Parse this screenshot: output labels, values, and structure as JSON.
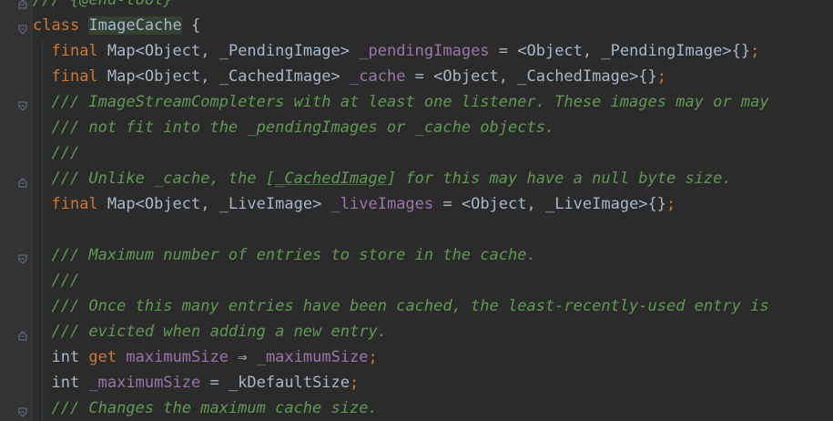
{
  "editor": {
    "lines": [
      [
        {
          "t": "/// {@end-tool}",
          "c": "doc"
        }
      ],
      [
        {
          "t": "class",
          "c": "kw"
        },
        {
          "t": " ",
          "c": "plain"
        },
        {
          "t": "ImageCache",
          "c": "hl plain"
        },
        {
          "t": " {",
          "c": "plain"
        }
      ],
      [
        {
          "t": "  ",
          "c": "plain"
        },
        {
          "t": "final",
          "c": "kw"
        },
        {
          "t": " Map<Object, _PendingImage> ",
          "c": "plain"
        },
        {
          "t": "_pendingImages",
          "c": "fld"
        },
        {
          "t": " = <Object, _PendingImage>{}",
          "c": "plain"
        },
        {
          "t": ";",
          "c": "kw"
        }
      ],
      [
        {
          "t": "  ",
          "c": "plain"
        },
        {
          "t": "final",
          "c": "kw"
        },
        {
          "t": " Map<Object, _CachedImage> ",
          "c": "plain"
        },
        {
          "t": "_cache",
          "c": "fld"
        },
        {
          "t": " = <Object, _CachedImage>{}",
          "c": "plain"
        },
        {
          "t": ";",
          "c": "kw"
        }
      ],
      [
        {
          "t": "  /// ImageStreamCompleters with at least one listener. These images may or may",
          "c": "doc"
        }
      ],
      [
        {
          "t": "  /// not fit into the _pendingImages or _cache objects.",
          "c": "doc"
        }
      ],
      [
        {
          "t": "  ///",
          "c": "doc"
        }
      ],
      [
        {
          "t": "  /// Unlike _cache, the [",
          "c": "doc"
        },
        {
          "t": "_CachedImage",
          "c": "doc-ref"
        },
        {
          "t": "] for this may have a null byte size.",
          "c": "doc"
        }
      ],
      [
        {
          "t": "  ",
          "c": "plain"
        },
        {
          "t": "final",
          "c": "kw"
        },
        {
          "t": " Map<Object, _LiveImage> ",
          "c": "plain"
        },
        {
          "t": "_liveImages",
          "c": "fld"
        },
        {
          "t": " = <Object, _LiveImage>{}",
          "c": "plain"
        },
        {
          "t": ";",
          "c": "kw"
        }
      ],
      [],
      [
        {
          "t": "  /// Maximum number of entries to store in the cache.",
          "c": "doc"
        }
      ],
      [
        {
          "t": "  ///",
          "c": "doc"
        }
      ],
      [
        {
          "t": "  /// Once this many entries have been cached, the least-recently-used entry is",
          "c": "doc"
        }
      ],
      [
        {
          "t": "  /// evicted when adding a new entry.",
          "c": "doc"
        }
      ],
      [
        {
          "t": "  int ",
          "c": "plain"
        },
        {
          "t": "get",
          "c": "kw"
        },
        {
          "t": " ",
          "c": "plain"
        },
        {
          "t": "maximumSize",
          "c": "fld"
        },
        {
          "t": " ⇒ ",
          "c": "plain"
        },
        {
          "t": "_maximumSize",
          "c": "fld"
        },
        {
          "t": ";",
          "c": "kw"
        }
      ],
      [
        {
          "t": "  int ",
          "c": "plain"
        },
        {
          "t": "_maximumSize",
          "c": "fld"
        },
        {
          "t": " = _kDefaultSize",
          "c": "plain"
        },
        {
          "t": ";",
          "c": "kw"
        }
      ],
      [
        {
          "t": "  /// Changes the maximum cache size.",
          "c": "doc"
        }
      ]
    ],
    "fold_markers": [
      {
        "line": 0,
        "icon": "fold-end-icon"
      },
      {
        "line": 1,
        "icon": "fold-start-icon"
      },
      {
        "line": 4,
        "icon": "fold-start-icon"
      },
      {
        "line": 7,
        "icon": "fold-end-icon"
      },
      {
        "line": 10,
        "icon": "fold-start-icon"
      },
      {
        "line": 13,
        "icon": "fold-end-icon"
      },
      {
        "line": 16,
        "icon": "fold-start-icon"
      }
    ]
  }
}
